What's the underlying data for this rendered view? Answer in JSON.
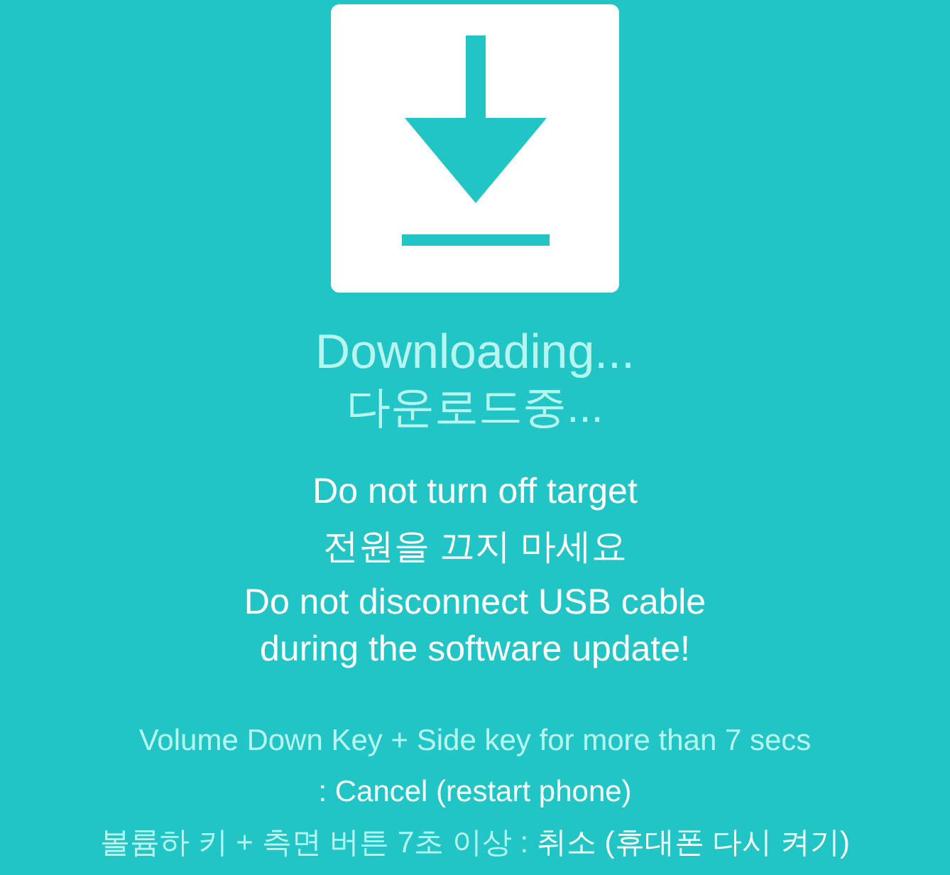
{
  "status": {
    "title": "Downloading...",
    "subtitle": "다운로드중..."
  },
  "warnings": [
    "Do not turn off target",
    "전원을 끄지 마세요",
    "Do not disconnect USB cable\nduring the software update!"
  ],
  "instructions": [
    {
      "segments": [
        {
          "text": "Volume Down Key + Side key for more than 7 secs",
          "emphasis": false
        }
      ]
    },
    {
      "segments": [
        {
          "text": ": Cancel (restart phone)",
          "emphasis": true
        }
      ]
    },
    {
      "segments": [
        {
          "text": "볼륨하 키 + 측면 버튼 7초 이상 : ",
          "emphasis": false
        },
        {
          "text": "취소 (휴대폰 다시 켜기)",
          "emphasis": true
        }
      ]
    }
  ]
}
